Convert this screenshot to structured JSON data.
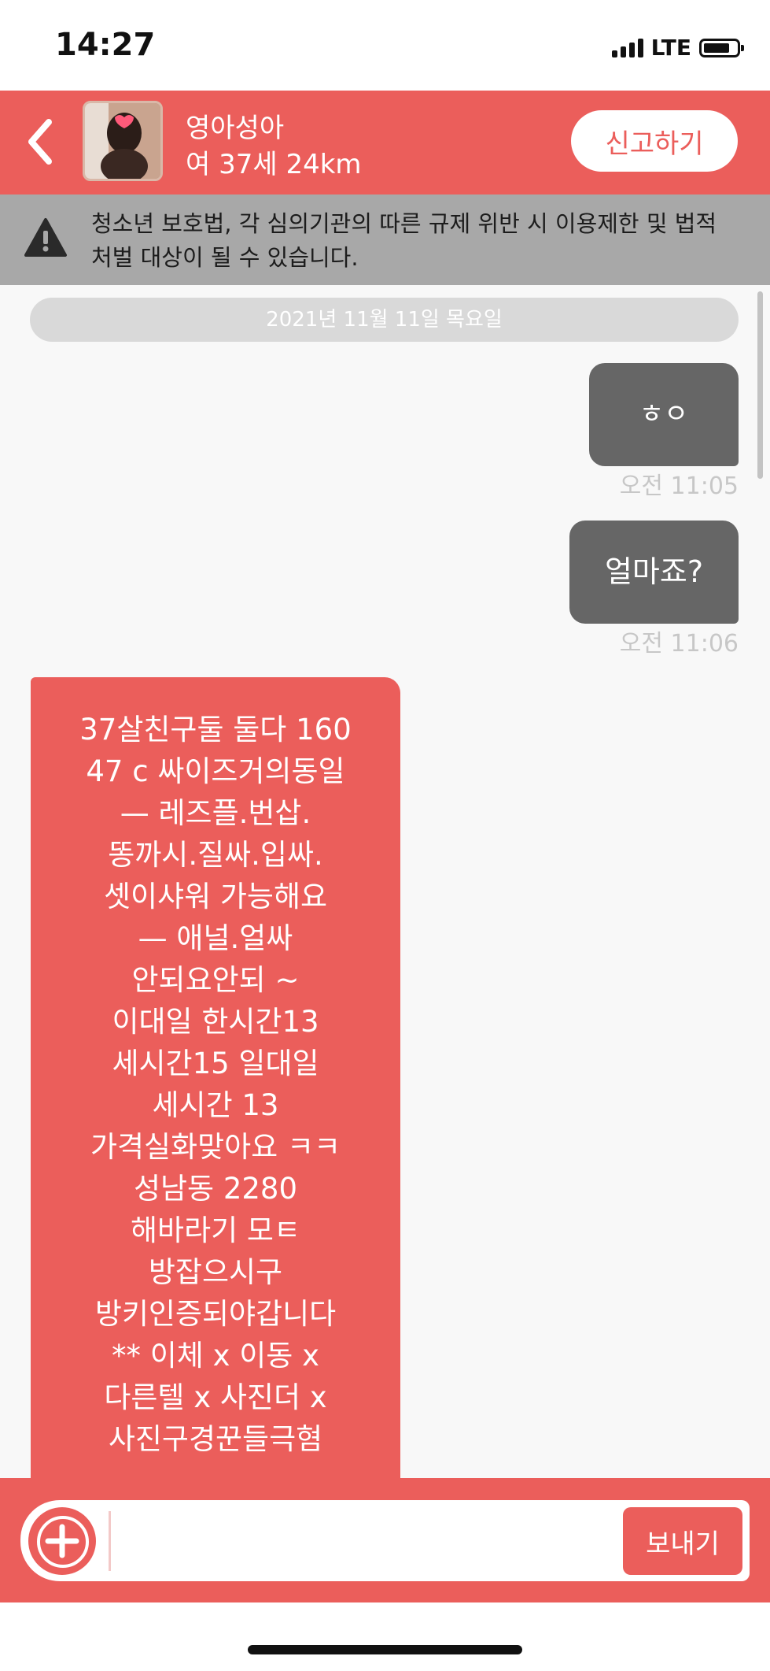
{
  "status_bar": {
    "time": "14:27",
    "network": "LTE"
  },
  "header": {
    "back_icon": "chevron-left-icon",
    "peer_name": "영아성아",
    "peer_info": "여 37세 24km",
    "report_label": "신고하기"
  },
  "warning": {
    "icon": "warning-triangle-icon",
    "text": "청소년 보호법, 각 심의기관의 따른 규제 위반 시 이용제한 및 법적처벌 대상이 될 수 있습니다."
  },
  "chat": {
    "date_divider": "2021년 11월 11일 목요일",
    "messages": [
      {
        "direction": "out",
        "text": "ㅎㅇ",
        "time": "오전 11:05"
      },
      {
        "direction": "out",
        "text": "얼마죠?",
        "time": "오전 11:06"
      },
      {
        "direction": "in",
        "text": "37살친구둘  둘다 160\n47  c  싸이즈거의동일\n—  레즈플.번삽.\n똥까시.질싸.입싸.\n셋이샤워  가능해요\n—    애널.얼싸\n안되요안되 ~\n이대일 한시간13\n세시간15      일대일\n세시간 13\n가격실화맞아요 ㅋㅋ\n성남동 2280\n해바라기 모ㅌ\n방잡으시구\n방키인증되야갑니다\n**  이체 x  이동 x\n다른텔 x 사진더 x\n사진구경꾼들극혐"
      }
    ]
  },
  "input": {
    "add_icon": "plus-circle-icon",
    "value": "",
    "send_label": "보내기"
  },
  "colors": {
    "brand": "#eb5e5b",
    "outgoing_bubble": "#666666",
    "warning_bg": "#a8a8a8"
  }
}
